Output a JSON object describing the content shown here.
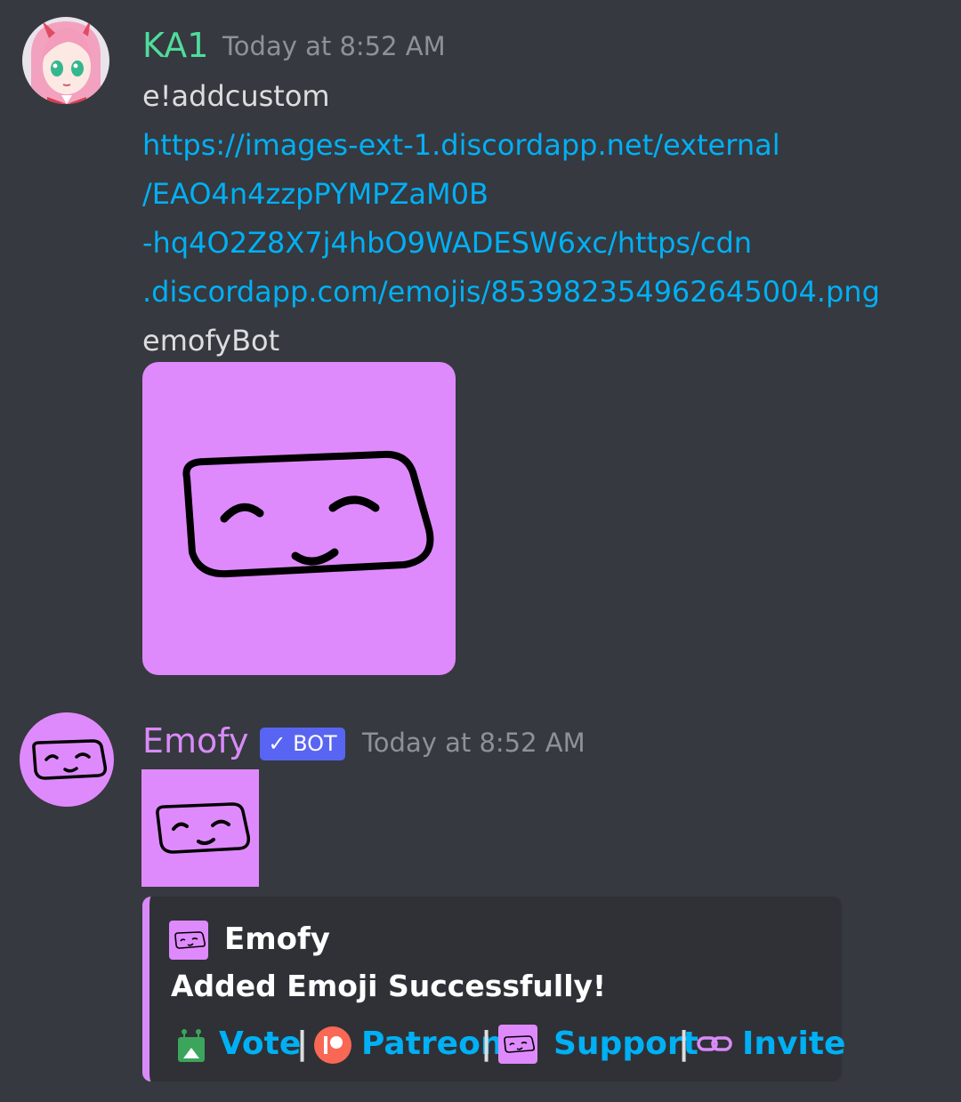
{
  "messages": [
    {
      "author": "KA1",
      "author_color": "#4fdc9c",
      "timestamp": "Today at 8:52 AM",
      "command": "e!addcustom",
      "link_lines": [
        "https://images-ext-1.discordapp.net/external",
        "/EAO4n4zzpPYMPZaM0B",
        "-hq4O2Z8X7j4hbO9WADESW6xc/https/cdn",
        ".discordapp.com/emojis/853982354962645004.png"
      ],
      "emoji_name": "emofyBot"
    },
    {
      "author": "Emofy",
      "author_color": "#d98af8",
      "bot_tag": "✓ BOT",
      "timestamp": "Today at 8:52 AM",
      "embed": {
        "color": "#d98af8",
        "author": "Emofy",
        "description": "Added Emoji Successfully!",
        "links": {
          "vote": "Vote",
          "patreon": "Patreon",
          "support": "Support",
          "invite": "Invite",
          "separator": "|"
        }
      }
    }
  ],
  "colors": {
    "background": "#36393f",
    "embed_background": "#2f3136",
    "link": "#00b0f4",
    "emoji_fill": "#df8afc",
    "bot_tag": "#5865f2",
    "patreon": "#f96854",
    "vote": "#3ba55c"
  },
  "icons": [
    "anime-avatar",
    "emofy-face",
    "topgg-icon",
    "patreon-icon",
    "link-icon",
    "checkmark-icon"
  ]
}
